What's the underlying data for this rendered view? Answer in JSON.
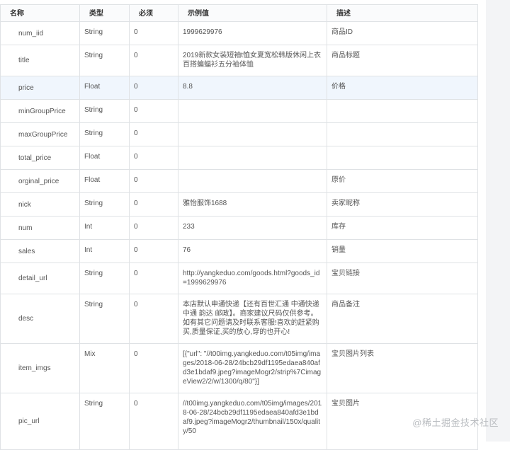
{
  "headers": [
    "名称",
    "类型",
    "必须",
    "示例值",
    "描述"
  ],
  "rows": [
    {
      "name": "num_iid",
      "type": "String",
      "required": "0",
      "example": "1999629976",
      "desc": "商品ID"
    },
    {
      "name": "title",
      "type": "String",
      "required": "0",
      "example": "2019新款女装短袖t恤女夏宽松韩版休闲上衣百搭蝙蝠衫五分袖体恤",
      "desc": "商品标题"
    },
    {
      "name": "price",
      "type": "Float",
      "required": "0",
      "example": "8.8",
      "desc": "价格"
    },
    {
      "name": "minGroupPrice",
      "type": "String",
      "required": "0",
      "example": "",
      "desc": ""
    },
    {
      "name": "maxGroupPrice",
      "type": "String",
      "required": "0",
      "example": "",
      "desc": ""
    },
    {
      "name": "total_price",
      "type": "Float",
      "required": "0",
      "example": "",
      "desc": ""
    },
    {
      "name": "orginal_price",
      "type": "Float",
      "required": "0",
      "example": "",
      "desc": "原价"
    },
    {
      "name": "nick",
      "type": "String",
      "required": "0",
      "example": "雅怡服饰1688",
      "desc": "卖家昵称"
    },
    {
      "name": "num",
      "type": "Int",
      "required": "0",
      "example": "233",
      "desc": "库存"
    },
    {
      "name": "sales",
      "type": "Int",
      "required": "0",
      "example": "76",
      "desc": "销量"
    },
    {
      "name": "detail_url",
      "type": "String",
      "required": "0",
      "example": "http://yangkeduo.com/goods.html?goods_id=1999629976",
      "desc": "宝贝链接"
    },
    {
      "name": "desc",
      "type": "String",
      "required": "0",
      "example": "本店默认申通快递【还有百世汇通 中通快递 中通 韵达 邮政】。商家建议尺码仅供参考。如有其它问题请及时联系客服!喜欢的赶紧购买,质量保证,买的放心,穿的也开心!",
      "desc": "商品备注"
    },
    {
      "name": "item_imgs",
      "type": "Mix",
      "required": "0",
      "example": "[{\"url\": \"//t00img.yangkeduo.com/t05img/images/2018-06-28/24bcb29df1195edaea840afd3e1bdaf9.jpeg?imageMogr2/strip%7CimageView2/2/w/1300/q/80\"}]",
      "desc": "宝贝图片列表"
    },
    {
      "name": "pic_url",
      "type": "String",
      "required": "0",
      "example": "//t00img.yangkeduo.com/t05img/images/2018-06-28/24bcb29df1195edaea840afd3e1bdaf9.jpeg?imageMogr2/thumbnail/150x/quality/50",
      "desc": "宝贝图片"
    }
  ],
  "watermark": "@稀土掘金技术社区"
}
